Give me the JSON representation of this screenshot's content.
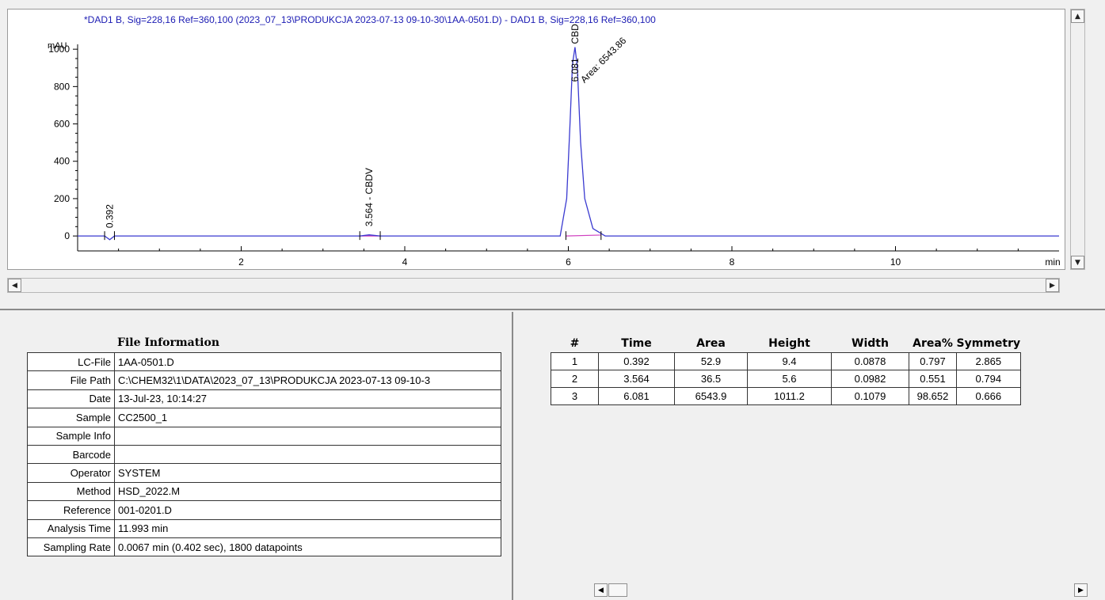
{
  "chart": {
    "title": "*DAD1 B, Sig=228,16 Ref=360,100 (2023_07_13\\PRODUKCJA 2023-07-13 09-10-30\\1AA-0501.D) - DAD1 B, Sig=228,16 Ref=360,100",
    "y_unit": "mAU",
    "x_unit": "min",
    "peak_labels": [
      "0.392",
      "3.564 - CBDV",
      "CBD",
      "6.081",
      "Area: 6543.86"
    ]
  },
  "chart_data": {
    "type": "line",
    "title": "*DAD1 B, Sig=228,16 Ref=360,100 (2023_07_13\\PRODUKCJA 2023-07-13 09-10-30\\1AA-0501.D) - DAD1 B, Sig=228,16 Ref=360,100",
    "xlabel": "min",
    "ylabel": "mAU",
    "xlim": [
      0,
      12
    ],
    "ylim": [
      -80,
      1060
    ],
    "xticks": [
      2,
      4,
      6,
      8,
      10
    ],
    "yticks": [
      0,
      200,
      400,
      600,
      800,
      1000
    ],
    "series": [
      {
        "x": [
          0,
          0.33,
          0.392,
          0.45,
          3.45,
          3.564,
          3.7,
          5.9,
          5.98,
          6.02,
          6.05,
          6.081,
          6.11,
          6.15,
          6.2,
          6.3,
          6.45,
          12
        ],
        "y": [
          0,
          0,
          -20,
          0,
          0,
          6,
          0,
          0,
          200,
          600,
          920,
          1011,
          900,
          500,
          200,
          40,
          0,
          0
        ]
      }
    ],
    "annotations": [
      "0.392",
      "3.564 - CBDV",
      "CBD",
      "6.081",
      "Area: 6543.86"
    ],
    "colors": {
      "signal": "#3a3ad0",
      "baseline": "#d040c0"
    }
  },
  "file_info": {
    "title": "File Information",
    "rows": [
      {
        "key": "LC-File",
        "value": "1AA-0501.D"
      },
      {
        "key": "File Path",
        "value": "C:\\CHEM32\\1\\DATA\\2023_07_13\\PRODUKCJA 2023-07-13 09-10-3"
      },
      {
        "key": "Date",
        "value": "13-Jul-23, 10:14:27"
      },
      {
        "key": "Sample",
        "value": "CC2500_1"
      },
      {
        "key": "Sample Info",
        "value": ""
      },
      {
        "key": "Barcode",
        "value": ""
      },
      {
        "key": "Operator",
        "value": "SYSTEM"
      },
      {
        "key": "Method",
        "value": "HSD_2022.M"
      },
      {
        "key": "Reference",
        "value": "001-0201.D"
      },
      {
        "key": "Analysis Time",
        "value": "11.993 min"
      },
      {
        "key": "Sampling Rate",
        "value": "0.0067 min  (0.402 sec),  1800 datapoints"
      }
    ]
  },
  "peaks": {
    "headers": [
      "#",
      "Time",
      "Area",
      "Height",
      "Width",
      "Area%",
      "Symmetry"
    ],
    "rows": [
      [
        "1",
        "0.392",
        "52.9",
        "9.4",
        "0.0878",
        "0.797",
        "2.865"
      ],
      [
        "2",
        "3.564",
        "36.5",
        "5.6",
        "0.0982",
        "0.551",
        "0.794"
      ],
      [
        "3",
        "6.081",
        "6543.9",
        "1011.2",
        "0.1079",
        "98.652",
        "0.666"
      ]
    ]
  },
  "scroll": {
    "up": "▲",
    "down": "▼",
    "left": "◀",
    "right": "▶"
  }
}
